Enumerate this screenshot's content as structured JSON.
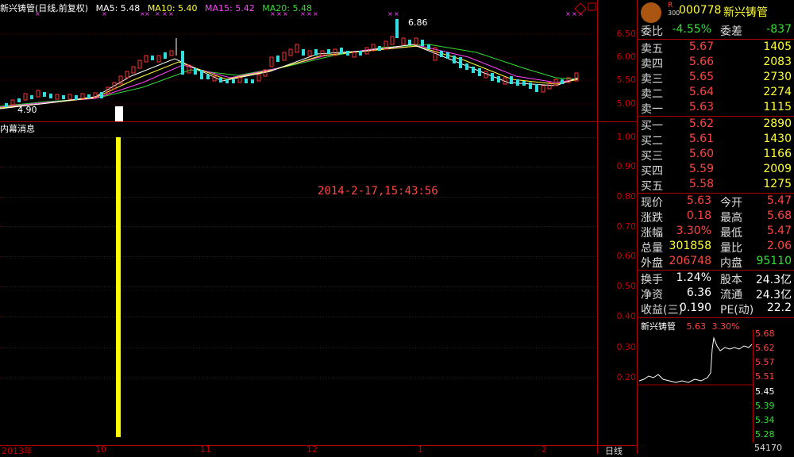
{
  "main_chart": {
    "title": "新兴铸管(日线,前复权)",
    "ma5_label": "MA5: 5.48",
    "ma10_label": "MA10: 5.40",
    "ma15_label": "MA15: 5.42",
    "ma20_label": "MA20: 5.48",
    "high_marker": "6.86",
    "low_marker": "4.90",
    "y_ticks": [
      "6.50",
      "6.00",
      "5.50",
      "5.00"
    ]
  },
  "sub_chart": {
    "title": "内幕消息",
    "timestamp": "2014-2-17,15:43:56",
    "y_ticks": [
      "1.00",
      "0.90",
      "0.80",
      "0.70",
      "0.60",
      "0.50",
      "0.40",
      "0.30",
      "0.20"
    ]
  },
  "x_axis": {
    "labels": [
      "2013年",
      "10",
      "11",
      "12",
      "1",
      "2"
    ],
    "period_label": "日线"
  },
  "quote": {
    "code": "000778",
    "name": "新兴铸管",
    "badge": "R",
    "badge2": "300",
    "weibi": {
      "k": "委比",
      "v": "-4.55%",
      "k2": "委差",
      "v2": "-837"
    },
    "sells": [
      {
        "k": "卖五",
        "price": "5.67",
        "vol": "1405"
      },
      {
        "k": "卖四",
        "price": "5.66",
        "vol": "2083"
      },
      {
        "k": "卖三",
        "price": "5.65",
        "vol": "2730"
      },
      {
        "k": "卖二",
        "price": "5.64",
        "vol": "2274"
      },
      {
        "k": "卖一",
        "price": "5.63",
        "vol": "1115"
      }
    ],
    "buys": [
      {
        "k": "买一",
        "price": "5.62",
        "vol": "2890"
      },
      {
        "k": "买二",
        "price": "5.61",
        "vol": "1430"
      },
      {
        "k": "买三",
        "price": "5.60",
        "vol": "1166"
      },
      {
        "k": "买四",
        "price": "5.59",
        "vol": "2009"
      },
      {
        "k": "买五",
        "price": "5.58",
        "vol": "1275"
      }
    ],
    "stats": [
      {
        "k": "现价",
        "v": "5.63",
        "k2": "今开",
        "v2": "5.47"
      },
      {
        "k": "涨跌",
        "v": "0.18",
        "k2": "最高",
        "v2": "5.68"
      },
      {
        "k": "涨幅",
        "v": "3.30%",
        "k2": "最低",
        "v2": "5.47"
      },
      {
        "k": "总量",
        "v": "301858",
        "k2": "量比",
        "v2": "2.06"
      },
      {
        "k": "外盘",
        "v": "206748",
        "k2": "内盘",
        "v2": "95110"
      }
    ],
    "fund": [
      {
        "k": "换手",
        "v": "1.24%",
        "k2": "股本",
        "v2": "24.3亿"
      },
      {
        "k": "净资",
        "v": "6.36",
        "k2": "流通",
        "v2": "24.3亿"
      },
      {
        "k": "收益(三)",
        "v": "0.190",
        "k2": "PE(动)",
        "v2": "22.2"
      }
    ],
    "mini_title": "新兴铸管",
    "mini_price": "5.63",
    "mini_pct": "3.30%",
    "mini_ticks_red": [
      "5.68",
      "5.62",
      "5.57",
      "5.51"
    ],
    "mini_tick_mid": "5.45",
    "mini_ticks_green": [
      "5.39",
      "5.34",
      "5.28"
    ],
    "mini_volume": "54170"
  }
}
